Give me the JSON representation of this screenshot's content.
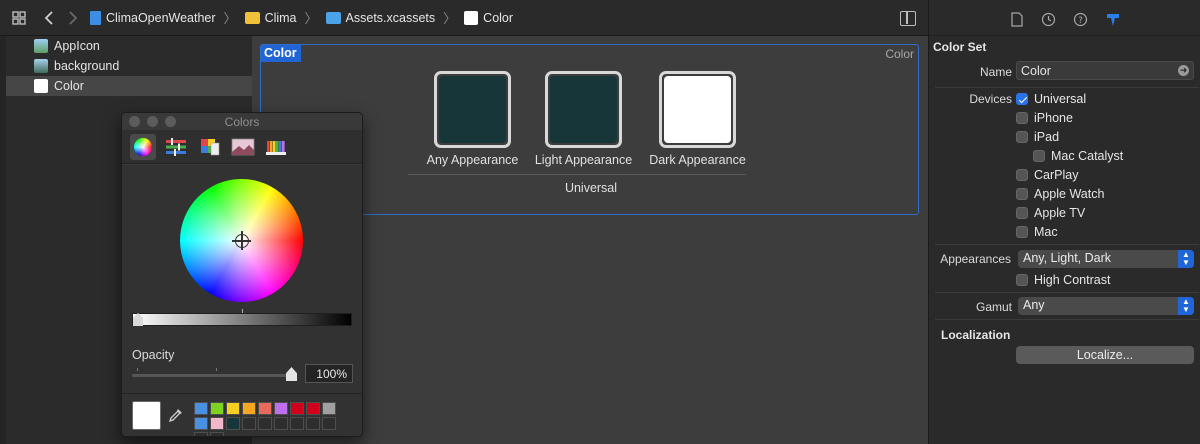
{
  "jumpbar": {
    "crumbs": [
      {
        "label": "ClimaOpenWeather",
        "icon": "swift-file-icon"
      },
      {
        "label": "Clima",
        "icon": "folder-icon"
      },
      {
        "label": "Assets.xcassets",
        "icon": "asset-catalog-icon"
      },
      {
        "label": "Color",
        "icon": "color-swatch-icon"
      }
    ]
  },
  "assets": [
    {
      "label": "AppIcon",
      "selected": false
    },
    {
      "label": "background",
      "selected": false
    },
    {
      "label": "Color",
      "selected": true
    }
  ],
  "editor": {
    "tag": "Color",
    "corner_label": "Color",
    "slots": [
      {
        "label": "Any Appearance",
        "color": "#16363a"
      },
      {
        "label": "Light Appearance",
        "color": "#16363a"
      },
      {
        "label": "Dark Appearance",
        "color": "#ffffff"
      }
    ],
    "group_label": "Universal"
  },
  "colors_panel": {
    "title": "Colors",
    "opacity_label": "Opacity",
    "opacity_value": "100%",
    "opacity_level": 1.0,
    "current_color": "#ffffff",
    "palette": [
      "#4a90e2",
      "#7ed321",
      "#f5d020",
      "#f5a623",
      "#e86a5c",
      "#bd6ff0",
      "#d0021b",
      "#d0021b",
      "#a0a0a0",
      "#4a90e2",
      "#f0b8c8",
      "#16363a",
      "#2e2e2e",
      "#2e2e2e",
      "#2e2e2e",
      "#2e2e2e",
      "#2e2e2e",
      "#2e2e2e",
      "#2e2e2e",
      "#2e2e2e"
    ]
  },
  "inspector": {
    "section_title": "Color Set",
    "name_label": "Name",
    "name_value": "Color",
    "devices_label": "Devices",
    "devices": [
      {
        "label": "Universal",
        "checked": true
      },
      {
        "label": "iPhone",
        "checked": false
      },
      {
        "label": "iPad",
        "checked": false
      },
      {
        "label": "Mac Catalyst",
        "checked": false
      },
      {
        "label": "CarPlay",
        "checked": false
      },
      {
        "label": "Apple Watch",
        "checked": false
      },
      {
        "label": "Apple TV",
        "checked": false
      },
      {
        "label": "Mac",
        "checked": false
      }
    ],
    "appearances_label": "Appearances",
    "appearances_value": "Any, Light, Dark",
    "high_contrast_label": "High Contrast",
    "gamut_label": "Gamut",
    "gamut_value": "Any",
    "localization_title": "Localization",
    "localize_button": "Localize..."
  }
}
